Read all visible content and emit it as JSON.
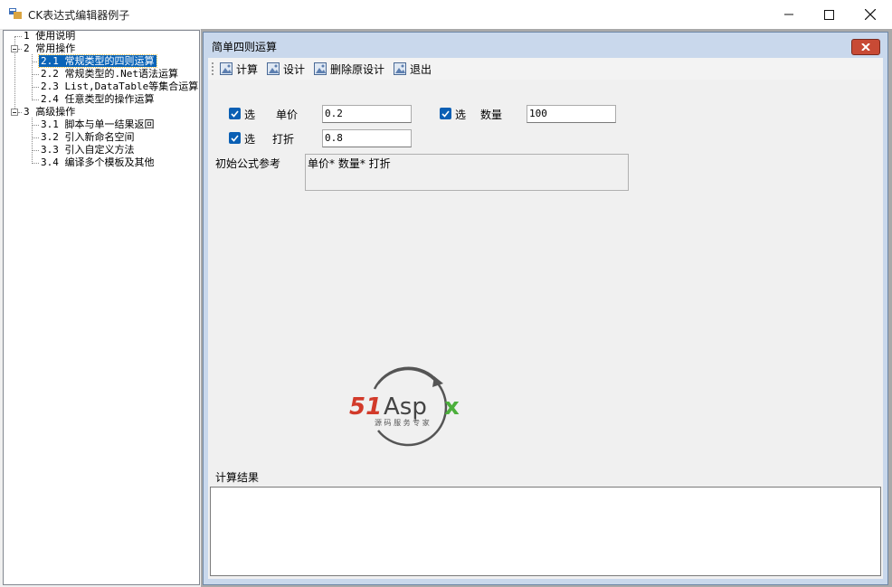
{
  "window": {
    "title": "CK表达式编辑器例子"
  },
  "tree": {
    "nodes": [
      {
        "label": "1 使用说明"
      },
      {
        "label": "2 常用操作"
      },
      {
        "label": "2.1 常规类型的四则运算"
      },
      {
        "label": "2.2 常规类型的.Net语法运算"
      },
      {
        "label": "2.3 List,DataTable等集合运算"
      },
      {
        "label": "2.4 任意类型的操作运算"
      },
      {
        "label": "3 高级操作"
      },
      {
        "label": "3.1 脚本与单一结果返回"
      },
      {
        "label": "3.2 引入新命名空间"
      },
      {
        "label": "3.3 引入自定义方法"
      },
      {
        "label": "3.4 编译多个模板及其他"
      }
    ]
  },
  "child": {
    "title": "简单四则运算",
    "toolbar": [
      "计算",
      "设计",
      "删除原设计",
      "退出"
    ],
    "fields": {
      "check_label": "选",
      "price_label": "单价",
      "price_value": "0.2",
      "qty_label": "数量",
      "qty_value": "100",
      "discount_label": "打折",
      "discount_value": "0.8"
    },
    "formula_label": "初始公式参考",
    "formula_value": "单价* 数量* 打折",
    "result_label": "计算结果",
    "result_value": ""
  },
  "logo": {
    "brand": "51Aspx",
    "tagline": "源码服务专家"
  },
  "colors": {
    "selection": "#0a64b8",
    "checkbox": "#0a5fb4",
    "close_red": "#c84a35"
  }
}
